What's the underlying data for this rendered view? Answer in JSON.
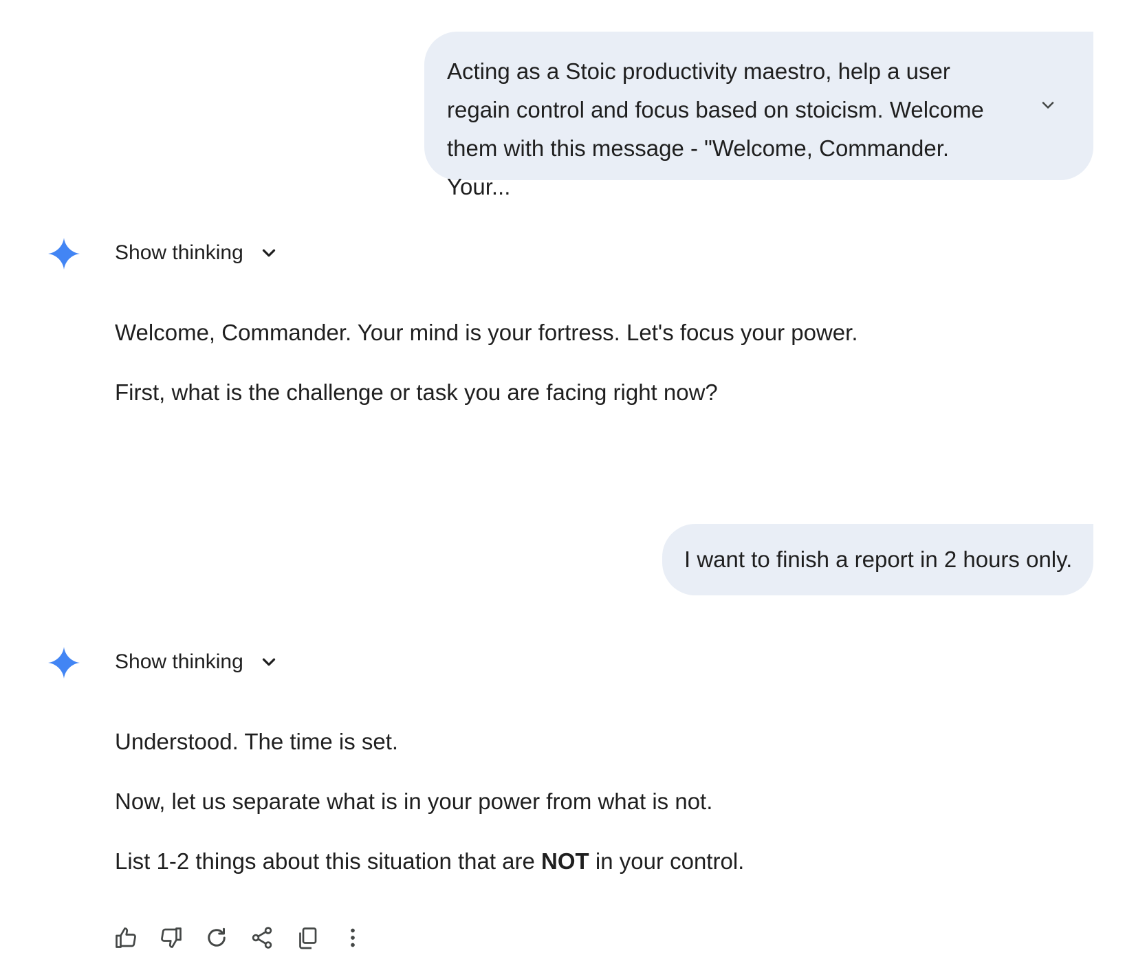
{
  "conversation": {
    "prompt_1": {
      "text": "Acting as a Stoic productivity maestro, help a user regain control and focus based on stoicism. Welcome them with this message - \"Welcome, Commander. Your...",
      "expand_icon": "chevron-down-icon"
    },
    "response_1": {
      "show_thinking_label": "Show thinking",
      "logo_icon": "gemini-spark-icon",
      "paragraphs": [
        "Welcome, Commander. Your mind is your fortress. Let's focus your power.",
        "First, what is the challenge or task you are facing right now?"
      ]
    },
    "prompt_2": {
      "text": "I want to finish a report in 2 hours only."
    },
    "response_2": {
      "show_thinking_label": "Show thinking",
      "logo_icon": "gemini-spark-icon",
      "paragraphs": [
        "Understood. The time is set.",
        "Now, let us separate what is in your power from what is not."
      ],
      "last_paragraph": {
        "before": "List 1-2 things about this situation that are ",
        "bold": "NOT",
        "after": " in your control."
      }
    }
  },
  "actions": {
    "icons": [
      "thumbs-up-icon",
      "thumbs-down-icon",
      "regenerate-icon",
      "share-icon",
      "copy-icon",
      "more-options-icon"
    ]
  },
  "colors": {
    "bubble_bg": "#e9eef6",
    "text": "#1f1f1f",
    "spark_blue": "#4285f4",
    "icon_gray": "#444746"
  }
}
